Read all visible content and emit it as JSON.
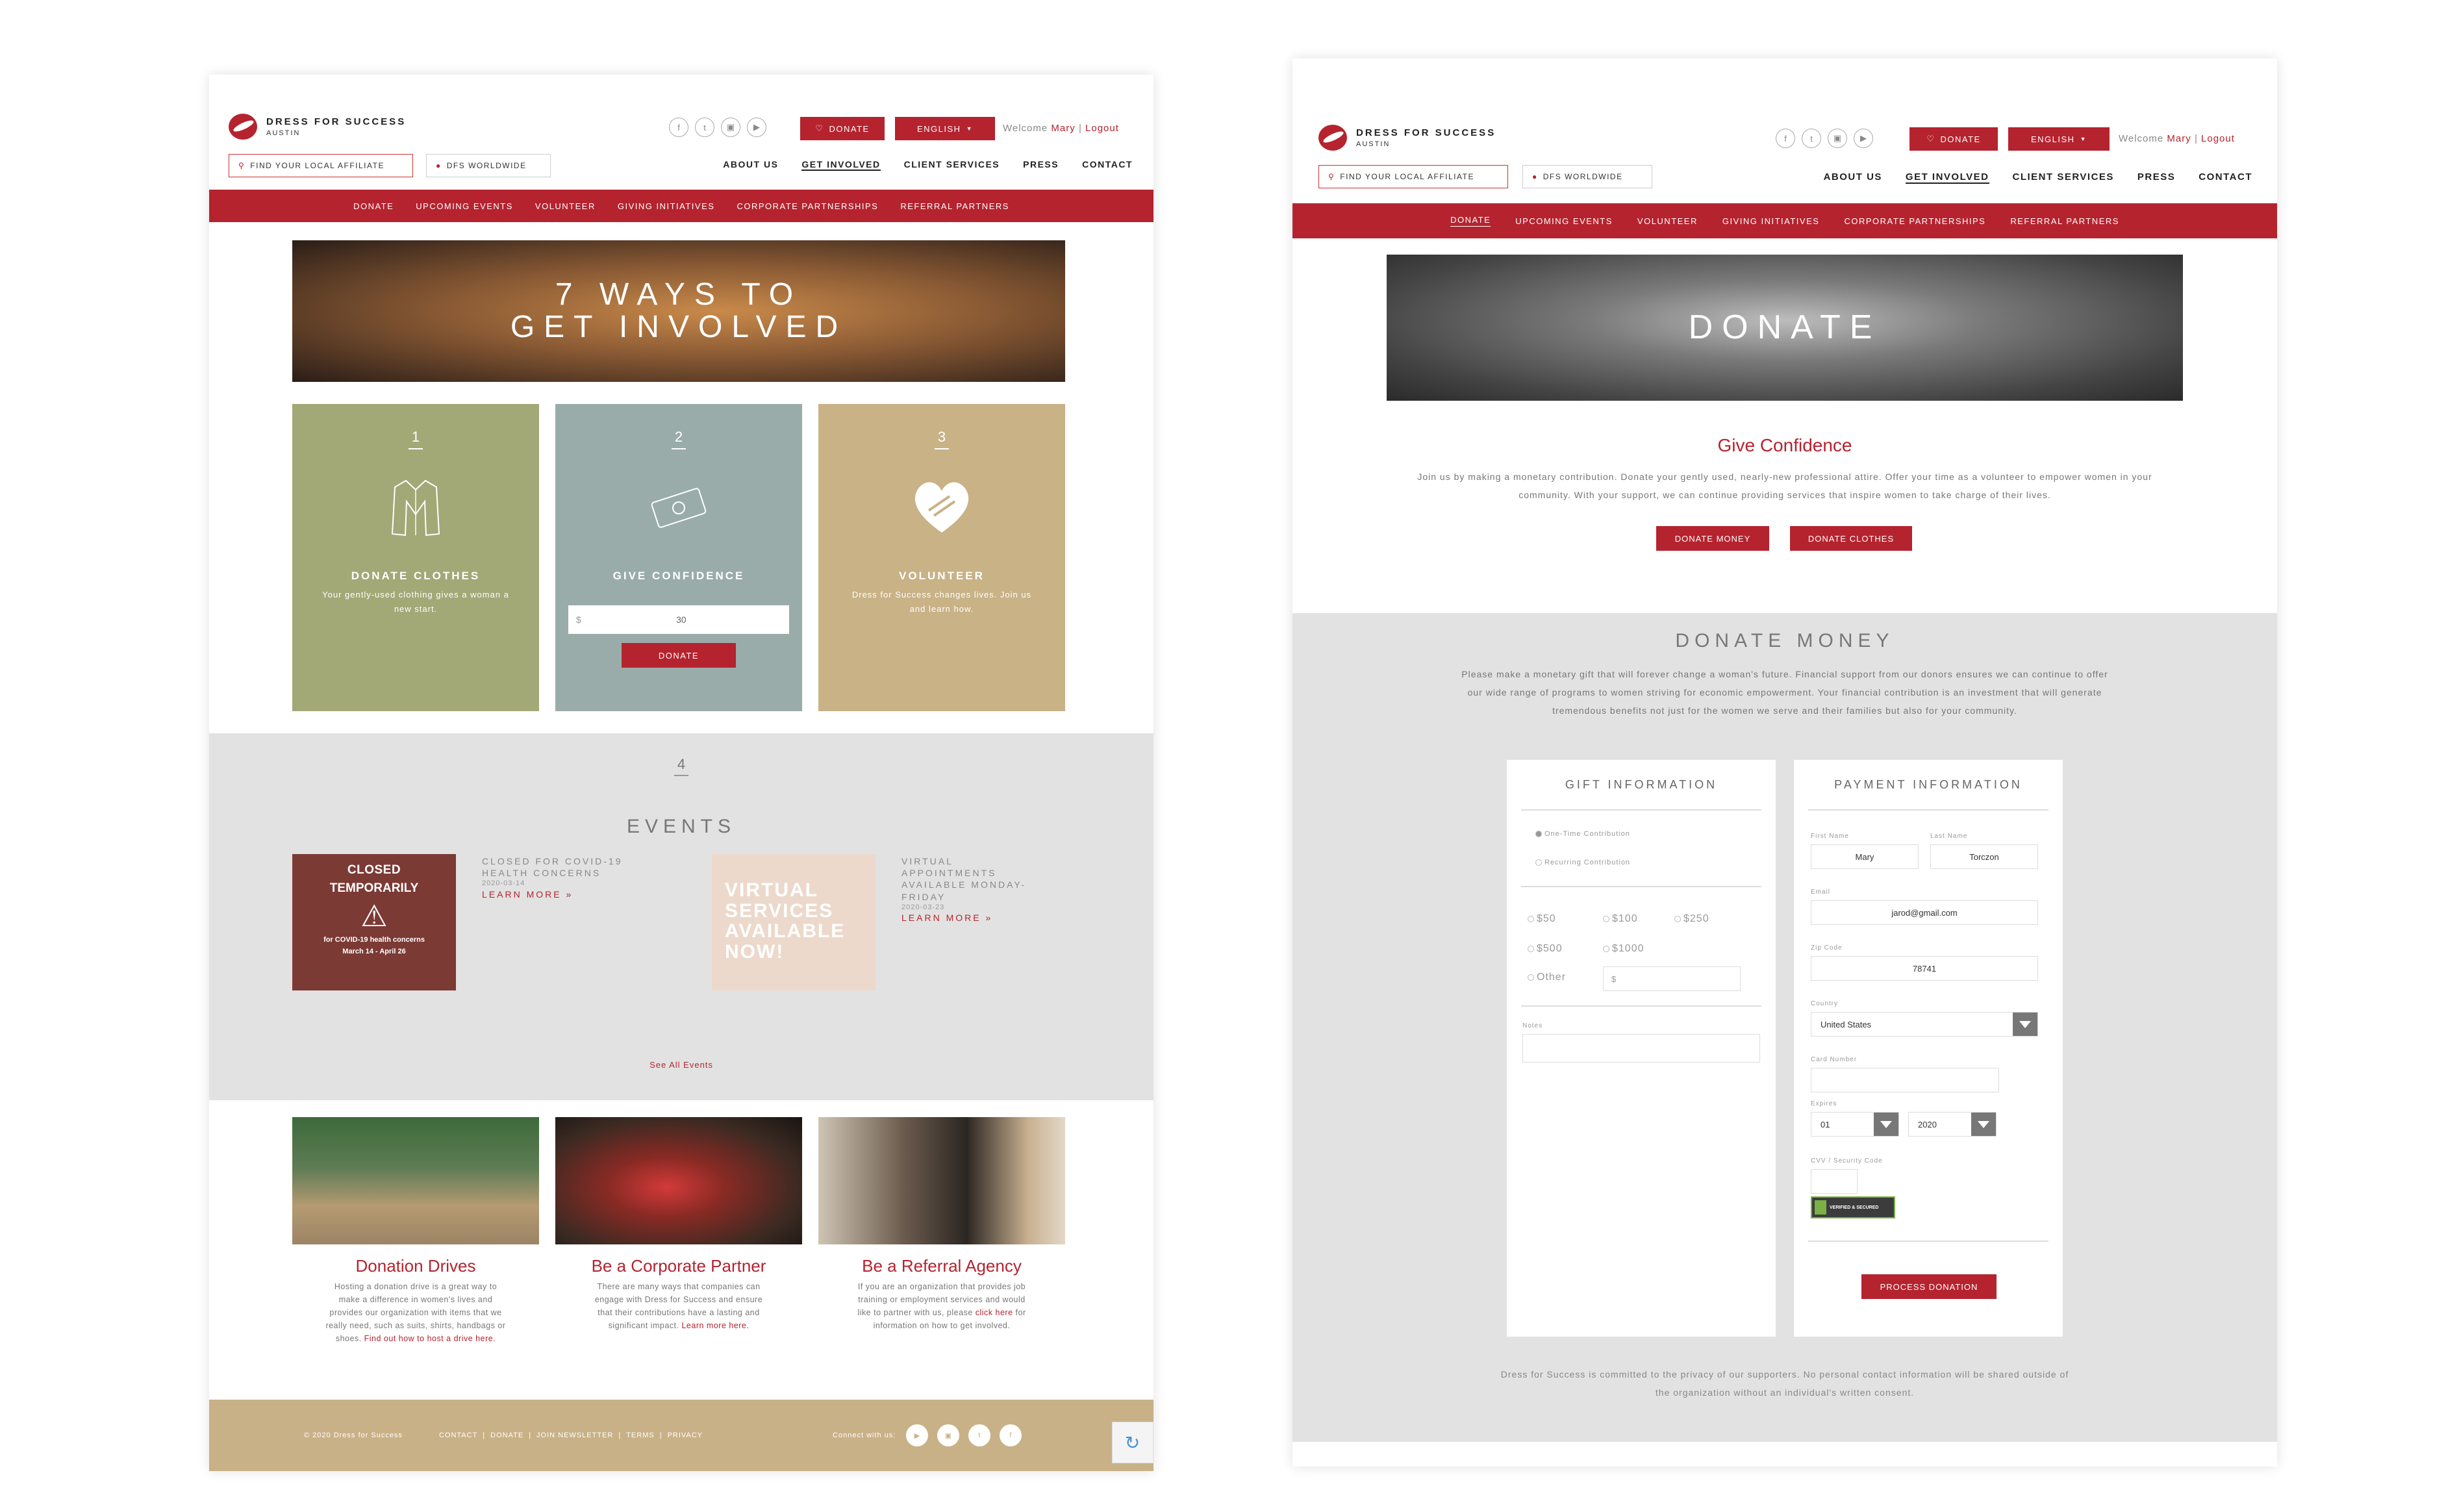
{
  "p1": {
    "logo": {
      "brand": "DRESS FOR SUCCESS",
      "city": "AUSTIN"
    },
    "header": {
      "find_affiliate": "FIND YOUR LOCAL AFFILIATE",
      "worldwide": "DFS WORLDWIDE",
      "donate": "DONATE",
      "language": "ENGLISH",
      "welcome": "Welcome",
      "user": "Mary",
      "sep": "|",
      "logout": "Logout",
      "nav": [
        "ABOUT US",
        "GET INVOLVED",
        "CLIENT SERVICES",
        "PRESS",
        "CONTACT"
      ]
    },
    "subnav": [
      "DONATE",
      "UPCOMING EVENTS",
      "VOLUNTEER",
      "GIVING INITIATIVES",
      "CORPORATE PARTNERSHIPS",
      "REFERRAL PARTNERS"
    ],
    "hero": {
      "line1": "7 WAYS TO",
      "line2": "GET INVOLVED"
    },
    "cards": [
      {
        "num": "1",
        "title": "DONATE CLOTHES",
        "desc": "Your gently-used clothing gives a woman a new start.",
        "color": "#a3a877"
      },
      {
        "num": "2",
        "title": "GIVE CONFIDENCE",
        "currency": "$",
        "amount": "30",
        "button": "DONATE",
        "color": "#9aacaa"
      },
      {
        "num": "3",
        "title": "VOLUNTEER",
        "desc": "Dress for Success changes lives. Join us and learn how.",
        "color": "#c8b286"
      }
    ],
    "events": {
      "num": "4",
      "title": "EVENTS",
      "closed_badge": {
        "line1": "CLOSED",
        "line2": "TEMPORARILY",
        "line3": "for COVID-19 health concerns",
        "line4": "March 14 - April 26"
      },
      "e1": {
        "title": "CLOSED FOR COVID-19 HEALTH CONCERNS",
        "date": "2020-03-14",
        "link": "LEARN MORE »"
      },
      "virtual_badge": "VIRTUAL SERVICES AVAILABLE NOW!",
      "e2": {
        "title": "VIRTUAL APPOINTMENTS AVAILABLE MONDAY-FRIDAY",
        "date": "2020-03-23",
        "link": "LEARN MORE »"
      },
      "see_all": "See All Events"
    },
    "promos": [
      {
        "title": "Donation Drives",
        "text": "Hosting a donation drive is a great way to make a difference in women's lives and provides our organization with items that we really need, such as suits, shirts, handbags or shoes.",
        "link": "Find out how to host a drive here."
      },
      {
        "title": "Be a Corporate Partner",
        "text": "There are many ways that companies can engage with Dress for Success and ensure that their contributions have a lasting and significant impact.",
        "link": "Learn more here."
      },
      {
        "title": "Be a Referral Agency",
        "text": "If you are an organization that provides job training or employment services and would like to partner with us, please",
        "link": "click here",
        "tail": "for information on how to get involved."
      }
    ],
    "footer": {
      "copyright": "© 2020 Dress for Success",
      "links": [
        "CONTACT",
        "DONATE",
        "JOIN NEWSLETTER",
        "TERMS",
        "PRIVACY"
      ],
      "connect": "Connect with us:"
    }
  },
  "p2": {
    "hero": "DONATE",
    "intro": {
      "title": "Give Confidence",
      "text": "Join us by making a monetary contribution. Donate your gently used, nearly-new professional attire. Offer your time as a volunteer to empower women in your community. With your support, we can continue providing services that inspire women to take charge of their lives.",
      "btn_money": "DONATE MONEY",
      "btn_clothes": "DONATE CLOTHES"
    },
    "donate_money": {
      "title": "DONATE MONEY",
      "text": "Please make a monetary gift that will forever change a woman's future. Financial support from our donors ensures we can continue to offer our wide range of programs to women striving for economic empowerment. Your financial contribution is an investment that will generate tremendous benefits not just for the women we serve and their families but also for your community."
    },
    "gift": {
      "title": "GIFT INFORMATION",
      "one_time": "One-Time Contribution",
      "recurring": "Recurring Contribution",
      "amounts": [
        "$50",
        "$100",
        "$250",
        "$500",
        "$1000"
      ],
      "other": "Other",
      "currency": "$",
      "notes": "Notes"
    },
    "payment": {
      "title": "PAYMENT INFORMATION",
      "first_name_label": "First Name",
      "last_name_label": "Last Name",
      "first_name": "Mary",
      "last_name": "Torczon",
      "email_label": "Email",
      "email": "jarod@gmail.com",
      "zip_label": "Zip Code",
      "zip": "78741",
      "country_label": "Country",
      "country": "United States",
      "card_label": "Card Number",
      "expires_label": "Expires",
      "month": "01",
      "year": "2020",
      "cvv_label": "CVV / Security Code",
      "secured": "VERIFIED & SECURED",
      "process": "PROCESS DONATION"
    },
    "privacy": "Dress for Success is committed to the privacy of our supporters. No personal contact information will be shared outside of the organization without an individual's written consent."
  }
}
